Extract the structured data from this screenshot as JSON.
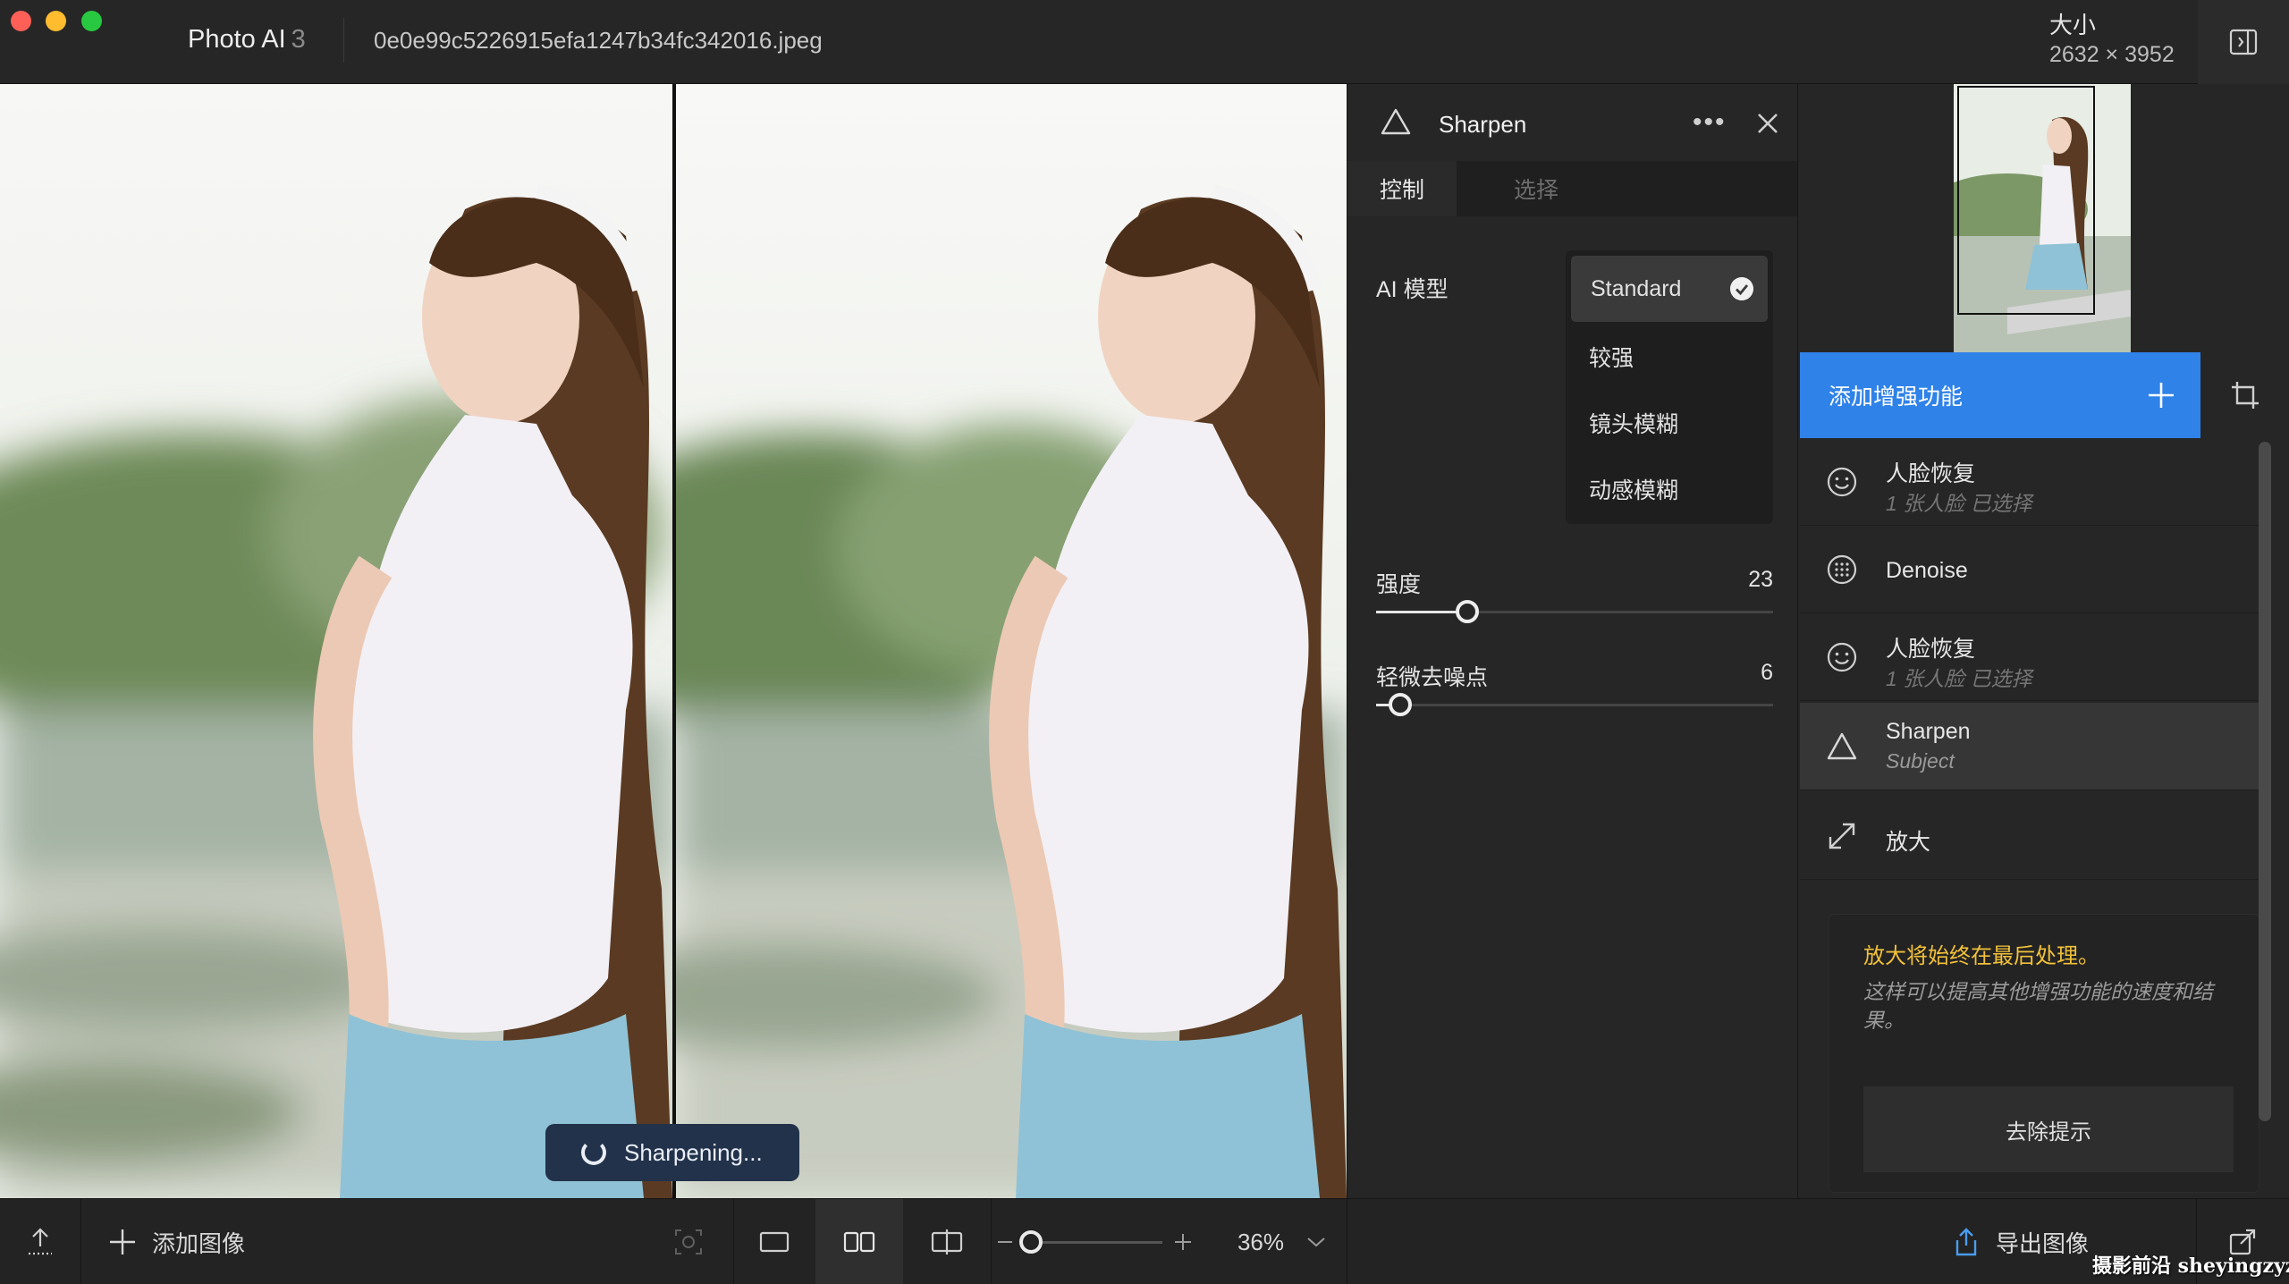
{
  "titlebar": {
    "app_name": "Photo AI",
    "app_version": "3",
    "file_name": "0e0e99c5226915efa1247b34fc342016.jpeg",
    "size_label": "大小",
    "size_value": "2632 × 3952"
  },
  "canvas": {
    "status_toast": "Sharpening..."
  },
  "sharpen_panel": {
    "title": "Sharpen",
    "more_label": "•••",
    "tabs": [
      {
        "label": "控制"
      },
      {
        "label": "选择"
      }
    ],
    "ai_model_label": "AI 模型",
    "models": [
      {
        "label": "Standard"
      },
      {
        "label": "较强"
      },
      {
        "label": "镜头模糊"
      },
      {
        "label": "动感模糊"
      }
    ],
    "params": [
      {
        "label": "强度",
        "value": "23",
        "level": 0.23
      },
      {
        "label": "轻微去噪点",
        "value": "6",
        "level": 0.06
      }
    ]
  },
  "right_panel": {
    "add_enhancement_label": "添加增强功能",
    "enhancements": [
      {
        "name": "人脸恢复",
        "sub": "1 张人脸 已选择",
        "icon": "face-icon"
      },
      {
        "name": "Denoise",
        "sub": "",
        "icon": "denoise-icon"
      },
      {
        "name": "人脸恢复",
        "sub": "1 张人脸 已选择",
        "icon": "face-icon"
      },
      {
        "name": "Sharpen",
        "sub": "Subject",
        "icon": "triangle-icon"
      },
      {
        "name": "放大",
        "sub": "",
        "icon": "upscale-icon"
      }
    ],
    "tip": {
      "title": "放大将始终在最后处理。",
      "body": "这样可以提高其他增强功能的速度和结果。",
      "button": "去除提示"
    }
  },
  "bottombar": {
    "add_image_label": "添加图像",
    "zoom_value": "36%",
    "export_label": "导出图像"
  },
  "watermark": "摄影前沿 sheyingzyz.com",
  "colors": {
    "accent_blue": "#2f82e8",
    "tip_yellow": "#f2c13a",
    "toast_bg": "#22324a"
  }
}
